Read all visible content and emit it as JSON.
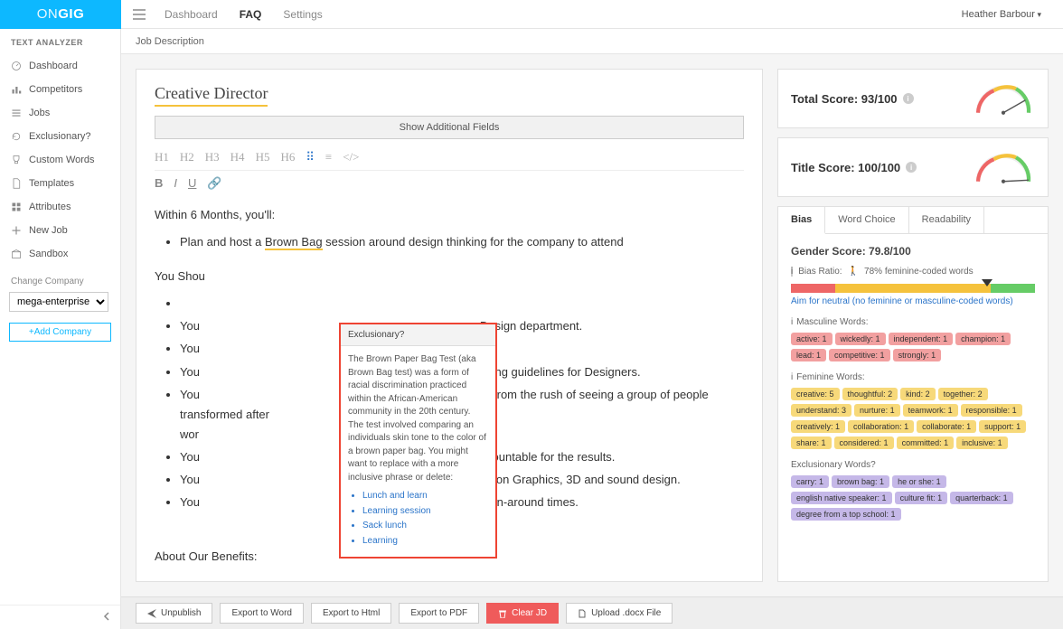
{
  "brand": {
    "first": "ON",
    "second": "GIG"
  },
  "topnav": {
    "dashboard": "Dashboard",
    "faq": "FAQ",
    "settings": "Settings"
  },
  "user": "Heather Barbour",
  "crumb": "Job Description",
  "sidebar": {
    "header": "TEXT ANALYZER",
    "items": [
      {
        "label": "Dashboard"
      },
      {
        "label": "Competitors"
      },
      {
        "label": "Jobs"
      },
      {
        "label": "Exclusionary?"
      },
      {
        "label": "Custom Words"
      },
      {
        "label": "Templates"
      },
      {
        "label": "Attributes"
      },
      {
        "label": "New Job"
      },
      {
        "label": "Sandbox"
      }
    ],
    "change_company": "Change Company",
    "company_value": "mega-enterprises",
    "add_company": "+Add Company"
  },
  "editor": {
    "title": "Creative Director",
    "show_fields": "Show Additional Fields",
    "toolbar_headers": [
      "H1",
      "H2",
      "H3",
      "H4",
      "H5",
      "H6"
    ],
    "section1_head": "Within 6 Months, you'll:",
    "bullet1_a": "Plan and host a ",
    "bullet1_hl": "Brown Bag",
    "bullet1_b": " session around design thinking for the company to attend",
    "section2_head": "You Shou",
    "frag_bullets_pre": "You",
    "frag_line1_end": "ve agency or a Design department.",
    "frag_line2_end": "ement experience.",
    "frag_line3_end": "ation and developing guidelines for Designers.",
    "frag_line4a": "ke great pleasure from the rush of seeing a group of people transformed after",
    "frag_line4b": "wor",
    "frag_line5_end": "elf and others accountable for the results.",
    "frag_line6_end": "nt production, Motion Graphics, 3D and sound design.",
    "frag_line7_end": "ojects with tight turn-around times.",
    "benefits_head": "About Our Benefits:"
  },
  "popup": {
    "title": "Exclusionary?",
    "body": "The Brown Paper Bag Test (aka Brown Bag test) was a form of racial discrimination practiced within the African-American community in the 20th century. The test involved comparing an individuals skin tone to the color of a brown paper bag. You might want to replace with a more inclusive phrase or delete:",
    "suggestions": [
      "Lunch and learn",
      "Learning session",
      "Sack lunch",
      "Learning"
    ]
  },
  "scores": {
    "total_label": "Total Score: 93/100",
    "title_label": "Title Score: 100/100"
  },
  "tabs": {
    "bias": "Bias",
    "word": "Word Choice",
    "read": "Readability"
  },
  "bias": {
    "heading": "Gender Score: 79.8/100",
    "ratio_label": "Bias Ratio:",
    "ratio_value": "78% feminine-coded words",
    "hint": "Aim for neutral (no feminine or masculine-coded words)",
    "masc_label": "Masculine Words:",
    "masc_words": [
      {
        "t": "active: 1"
      },
      {
        "t": "wickedly: 1"
      },
      {
        "t": "independent: 1"
      },
      {
        "t": "champion: 1"
      },
      {
        "t": "lead: 1"
      },
      {
        "t": "competitive: 1"
      },
      {
        "t": "strongly: 1"
      }
    ],
    "fem_label": "Feminine Words:",
    "fem_words": [
      {
        "t": "creative: 5"
      },
      {
        "t": "thoughtful: 2"
      },
      {
        "t": "kind: 2"
      },
      {
        "t": "together: 2"
      },
      {
        "t": "understand: 3"
      },
      {
        "t": "nurture: 1"
      },
      {
        "t": "teamwork: 1"
      },
      {
        "t": "responsible: 1"
      },
      {
        "t": "creatively: 1"
      },
      {
        "t": "collaboration: 1"
      },
      {
        "t": "collaborate: 1"
      },
      {
        "t": "support: 1"
      },
      {
        "t": "share: 1"
      },
      {
        "t": "considered: 1"
      },
      {
        "t": "committed: 1"
      },
      {
        "t": "inclusive: 1"
      }
    ],
    "excl_label": "Exclusionary Words?",
    "excl_words": [
      {
        "t": "carry: 1"
      },
      {
        "t": "brown bag: 1"
      },
      {
        "t": "he or she: 1"
      },
      {
        "t": "english native speaker: 1"
      },
      {
        "t": "culture fit: 1"
      },
      {
        "t": "quarterback: 1"
      },
      {
        "t": "degree from a top school: 1"
      }
    ]
  },
  "bottombar": {
    "unpublish": "Unpublish",
    "export_word": "Export to Word",
    "export_html": "Export to Html",
    "export_pdf": "Export to PDF",
    "clear": "Clear JD",
    "upload": "Upload .docx File"
  }
}
